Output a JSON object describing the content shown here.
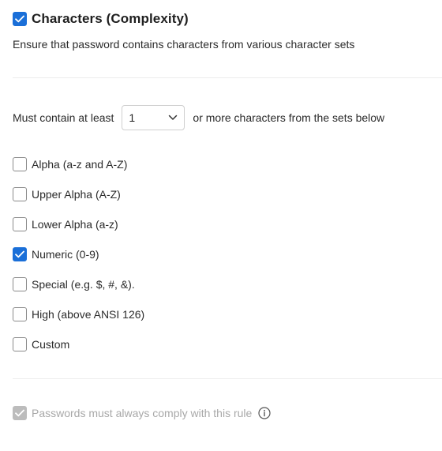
{
  "header": {
    "title": "Characters (Complexity)",
    "checked": true
  },
  "description": "Ensure that password contains characters from various character sets",
  "must_contain": {
    "prefix": "Must contain at least",
    "selected_value": "1",
    "suffix": "or more characters from the sets below"
  },
  "character_sets": [
    {
      "label": "Alpha (a-z and A-Z)",
      "checked": false
    },
    {
      "label": "Upper Alpha (A-Z)",
      "checked": false
    },
    {
      "label": "Lower Alpha (a-z)",
      "checked": false
    },
    {
      "label": "Numeric (0-9)",
      "checked": true
    },
    {
      "label": "Special (e.g. $, #, &).",
      "checked": false
    },
    {
      "label": "High (above ANSI 126)",
      "checked": false
    },
    {
      "label": "Custom",
      "checked": false
    }
  ],
  "comply": {
    "label": "Passwords must always comply with this rule",
    "checked": true,
    "disabled": true
  },
  "colors": {
    "accent": "#1a6fd8",
    "disabled": "#bcbcbc",
    "muted_text": "#a8a8a8"
  },
  "icons": {
    "dropdown": "chevron-down-icon",
    "info": "info-icon",
    "check": "checkmark-icon"
  }
}
